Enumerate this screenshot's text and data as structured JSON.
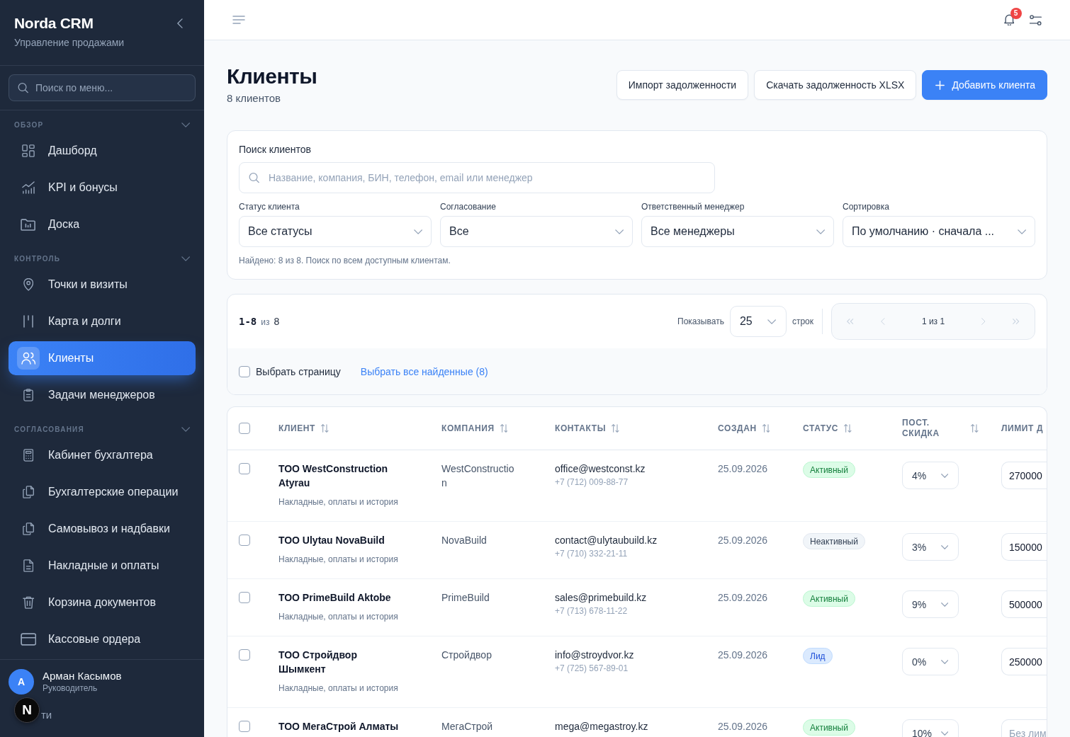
{
  "sidebar": {
    "brand": "Norda CRM",
    "subtitle": "Управление продажами",
    "search": {
      "placeholder": "Поиск по меню..."
    },
    "sections": [
      {
        "title": "ОБЗОР",
        "expanded": true,
        "items": [
          {
            "label": "Дашборд",
            "selected": false
          },
          {
            "label": "KPI и бонусы",
            "selected": false
          },
          {
            "label": "Доска",
            "selected": false
          }
        ]
      },
      {
        "title": "КОНТРОЛЬ",
        "expanded": true,
        "items": [
          {
            "label": "Точки и визиты",
            "selected": false
          },
          {
            "label": "Карта и долги",
            "selected": false
          },
          {
            "label": "Клиенты",
            "selected": true
          },
          {
            "label": "Задачи менеджеров",
            "selected": false
          }
        ]
      },
      {
        "title": "СОГЛАСОВАНИЯ",
        "expanded": true,
        "items": [
          {
            "label": "Кабинет бухгалтера",
            "selected": false
          },
          {
            "label": "Бухгалтерские операции",
            "selected": false
          },
          {
            "label": "Самовывоз и надбавки",
            "selected": false
          },
          {
            "label": "Накладные и оплаты",
            "selected": false
          },
          {
            "label": "Корзина документов",
            "selected": false
          },
          {
            "label": "Кассовые ордера",
            "selected": false
          }
        ]
      }
    ],
    "user": {
      "initial": "А",
      "name": "Арман Касымов",
      "role": "Руководитель"
    },
    "footer_link": "ти"
  },
  "dev_badge": {
    "label": "N"
  },
  "topbar": {
    "notification_count": "5"
  },
  "header": {
    "title": "Клиенты",
    "subtitle": "8 клиентов",
    "actions": [
      {
        "label": "Импорт задолженности",
        "kind": "secondary"
      },
      {
        "label": "Скачать задолженность XLSX",
        "kind": "secondary"
      },
      {
        "label": "Добавить клиента",
        "kind": "primary"
      }
    ]
  },
  "filters": {
    "search_label": "Поиск клиентов",
    "search": {
      "placeholder": "Название, компания, БИН, телефон, email или менеджер"
    },
    "selects": [
      {
        "label": "Статус клиента",
        "value": "Все статусы"
      },
      {
        "label": "Согласование",
        "value": "Все"
      },
      {
        "label": "Ответственный менеджер",
        "value": "Все менеджеры"
      },
      {
        "label": "Сортировка",
        "value": "По умолчанию · сначала ..."
      }
    ],
    "summary": "Найдено: 8 из 8. Поиск по всем доступным клиентам."
  },
  "pagination": {
    "range": "1-8",
    "of": "из",
    "total": "8",
    "show_label": "Показывать",
    "page_size": "25",
    "rows_label": "строк",
    "pager": [
      {
        "kind": "first",
        "disabled": true
      },
      {
        "kind": "prev",
        "disabled": true
      },
      {
        "kind": "label",
        "text": "1 из 1"
      },
      {
        "kind": "next",
        "disabled": true
      },
      {
        "kind": "last",
        "disabled": true
      }
    ],
    "select_page": {
      "label": "Выбрать страницу",
      "checked": false
    },
    "select_all": "Выбрать все найденные (8)"
  },
  "table": {
    "all_checked": false,
    "columns": [
      {
        "label": "КЛИЕНТ",
        "sortable": true
      },
      {
        "label": "КОМПАНИЯ",
        "sortable": true
      },
      {
        "label": "КОНТАКТЫ",
        "sortable": true
      },
      {
        "label": "СОЗДАН",
        "sortable": true
      },
      {
        "label": "СТАТУС",
        "sortable": true
      },
      {
        "label": "ПОСТ. СКИДКА",
        "sortable": true
      },
      {
        "label": "ЛИМИТ Д",
        "sortable": false
      }
    ],
    "rows": [
      {
        "selected": false,
        "client": "ТОО WestConstruction Atyrau",
        "details": "Накладные, оплаты и история",
        "company": "WestConstruction",
        "email": "office@westconst.kz",
        "phone": "+7 (712) 009-88-77",
        "created": "25.09.2026",
        "status": {
          "label": "Активный",
          "kind": "active"
        },
        "discount": "4%",
        "limit": {
          "value": "270000"
        }
      },
      {
        "selected": false,
        "client": "ТОО Ulytau NovaBuild",
        "details": "Накладные, оплаты и история",
        "company": "NovaBuild",
        "email": "contact@ulytaubuild.kz",
        "phone": "+7 (710) 332-21-11",
        "created": "25.09.2026",
        "status": {
          "label": "Неактивный",
          "kind": "inactive"
        },
        "discount": "3%",
        "limit": {
          "value": "150000"
        }
      },
      {
        "selected": false,
        "client": "ТОО PrimeBuild Aktobe",
        "details": "Накладные, оплаты и история",
        "company": "PrimeBuild",
        "email": "sales@primebuild.kz",
        "phone": "+7 (713) 678-11-22",
        "created": "25.09.2026",
        "status": {
          "label": "Активный",
          "kind": "active"
        },
        "discount": "9%",
        "limit": {
          "value": "500000"
        }
      },
      {
        "selected": false,
        "client": "ТОО Стройдвор Шымкент",
        "details": "Накладные, оплаты и история",
        "company": "Стройдвор",
        "email": "info@stroydvor.kz",
        "phone": "+7 (725) 567-89-01",
        "created": "25.09.2026",
        "status": {
          "label": "Лид",
          "kind": "lead"
        },
        "discount": "0%",
        "limit": {
          "value": "250000"
        }
      },
      {
        "selected": false,
        "client": "ТОО МегаСтрой Алматы",
        "company": "МегаСтрой",
        "email": "mega@megastroy.kz",
        "created": "25.09.2026",
        "status": {
          "label": "Активный",
          "kind": "active"
        },
        "discount": "10%",
        "limit": {
          "placeholder": "Без лим"
        }
      }
    ]
  }
}
